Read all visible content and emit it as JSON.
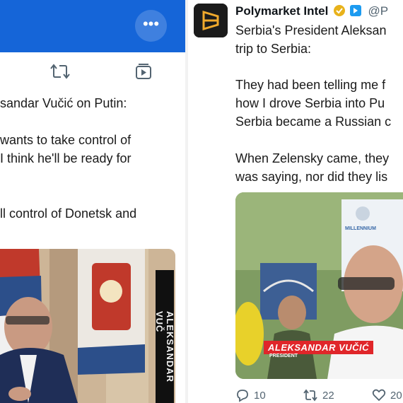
{
  "left_tweet": {
    "more_label": "•••",
    "icons": {
      "retweet": "retweet-icon",
      "bookmark": "media-bookmark-icon",
      "more": "more-icon"
    },
    "text_lines": [
      "sandar Vučić on Putin:",
      "wants to take control of",
      "I think he'll be ready for",
      "ll control of Donetsk and"
    ],
    "media": {
      "overlay_name": "ALEKSANDAR VUČ"
    }
  },
  "right_tweet": {
    "author_name": "Polymarket Intel",
    "handle": "@P",
    "text_lines": [
      "Serbia's President Aleksan",
      "trip to Serbia:",
      "They had been telling me f",
      "how I drove Serbia into Pu",
      "Serbia became a Russian c",
      "When Zelensky came, they",
      "was saying, nor did they lis"
    ],
    "media": {
      "caption_name": "ALEKSANDAR VUČIĆ",
      "caption_role": "PRESIDENT",
      "banner_text": "MILLENNIUM"
    },
    "stats": {
      "replies": "10",
      "reposts": "22",
      "likes": "20"
    },
    "colors": {
      "verified_gold": "#e8b21b",
      "blue_badge": "#1d9bf0",
      "caption_red": "#e0262a"
    }
  }
}
